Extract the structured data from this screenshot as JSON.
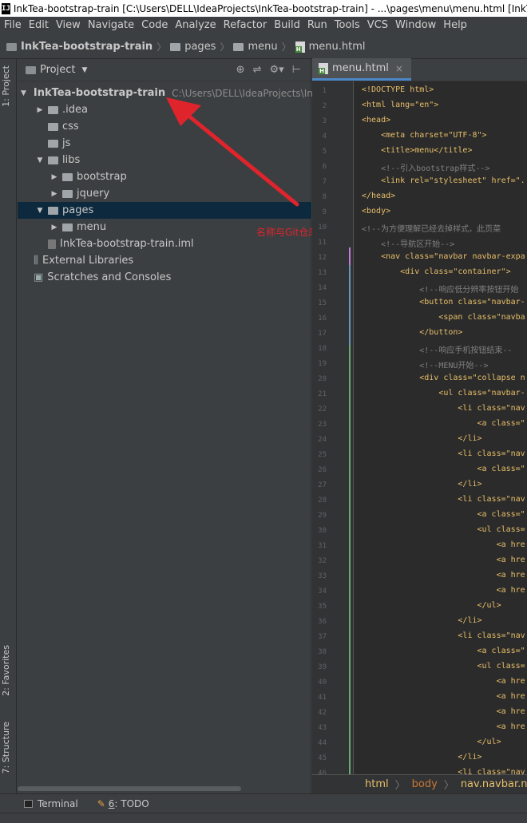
{
  "window": {
    "icon_text": "IJ",
    "title": "InkTea-bootstrap-train [C:\\Users\\DELL\\IdeaProjects\\InkTea-bootstrap-train] - ...\\pages\\menu\\menu.html [InkTe"
  },
  "menubar": [
    "File",
    "Edit",
    "View",
    "Navigate",
    "Code",
    "Analyze",
    "Refactor",
    "Build",
    "Run",
    "Tools",
    "VCS",
    "Window",
    "Help"
  ],
  "breadcrumb": [
    "InkTea-bootstrap-train",
    "pages",
    "menu",
    "menu.html"
  ],
  "left_tabs": {
    "project": "1: Project",
    "favorites": "2: Favorites",
    "structure": "7: Structure"
  },
  "project_panel": {
    "title": "Project",
    "tools": [
      "⊕",
      "⇌",
      "⚙▾",
      "⊢"
    ],
    "tree": [
      {
        "label": "InkTea-bootstrap-train",
        "path": "C:\\Users\\DELL\\IdeaProjects\\Ink",
        "icon": "module-folder-icon",
        "expanded": true,
        "bold": true
      },
      {
        "label": ".idea",
        "icon": "folder-icon",
        "expanded": false
      },
      {
        "label": "css",
        "icon": "folder-icon"
      },
      {
        "label": "js",
        "icon": "folder-icon"
      },
      {
        "label": "libs",
        "icon": "folder-icon",
        "expanded": true
      },
      {
        "label": "bootstrap",
        "icon": "folder-icon",
        "expanded": false
      },
      {
        "label": "jquery",
        "icon": "folder-icon",
        "expanded": false
      },
      {
        "label": "pages",
        "icon": "folder-icon",
        "expanded": true,
        "selected": true
      },
      {
        "label": "menu",
        "icon": "folder-icon",
        "expanded": false
      },
      {
        "label": "InkTea-bootstrap-train.iml",
        "icon": "iml-file-icon"
      },
      {
        "label": "External Libraries",
        "icon": "libraries-icon"
      },
      {
        "label": "Scratches and Consoles",
        "icon": "scratches-icon"
      }
    ]
  },
  "annotation": {
    "text": "名称与Git仓库相同",
    "color": "#e0242c"
  },
  "editor": {
    "tab": "menu.html",
    "lines": [
      "<!DOCTYPE html>",
      "<html lang=\"en\">",
      "<head>",
      "    <meta charset=\"UTF-8\">",
      "    <title>menu</title>",
      "    <!--引入bootstrap样式-->",
      "    <link rel=\"stylesheet\" href=\".",
      "</head>",
      "<body>",
      "<!--为方便理解已经去掉样式，此页菜",
      "    <!--导航区开始-->",
      "    <nav class=\"navbar navbar-expa",
      "        <div class=\"container\">",
      "            <!--响应低分辨率按钮开始",
      "            <button class=\"navbar-",
      "                <span class=\"navba",
      "            </button>",
      "            <!--响应手机按钮结束--",
      "            <!--MENU开始-->",
      "            <div class=\"collapse n",
      "                <ul class=\"navbar-",
      "                    <li class=\"nav",
      "                        <a class=\"",
      "                    </li>",
      "                    <li class=\"nav",
      "                        <a class=\"",
      "                    </li>",
      "                    <li class=\"nav",
      "                        <a class=\"",
      "                        <ul class=",
      "                            <a hre",
      "                            <a hre",
      "                            <a hre",
      "                            <a hre",
      "                        </ul>",
      "                    </li>",
      "                    <li class=\"nav",
      "                        <a class=\"",
      "                        <ul class=",
      "                            <a hre",
      "                            <a hre",
      "                            <a hre",
      "                            <a hre",
      "                        </ul>",
      "                    </li>",
      "                    <li class=\"nav"
    ],
    "status_path": [
      "html",
      "body",
      "nav.navbar.navba"
    ]
  },
  "bottom_bar": {
    "terminal": "Terminal",
    "todo_prefix": "6",
    "todo_label": ": TODO"
  },
  "colors": {
    "background": "#3c3f41",
    "editor_bg": "#2b2b2b",
    "selection": "#0d293e",
    "tag": "#e8bf6a",
    "string": "#6a8759",
    "comment": "#808080"
  }
}
